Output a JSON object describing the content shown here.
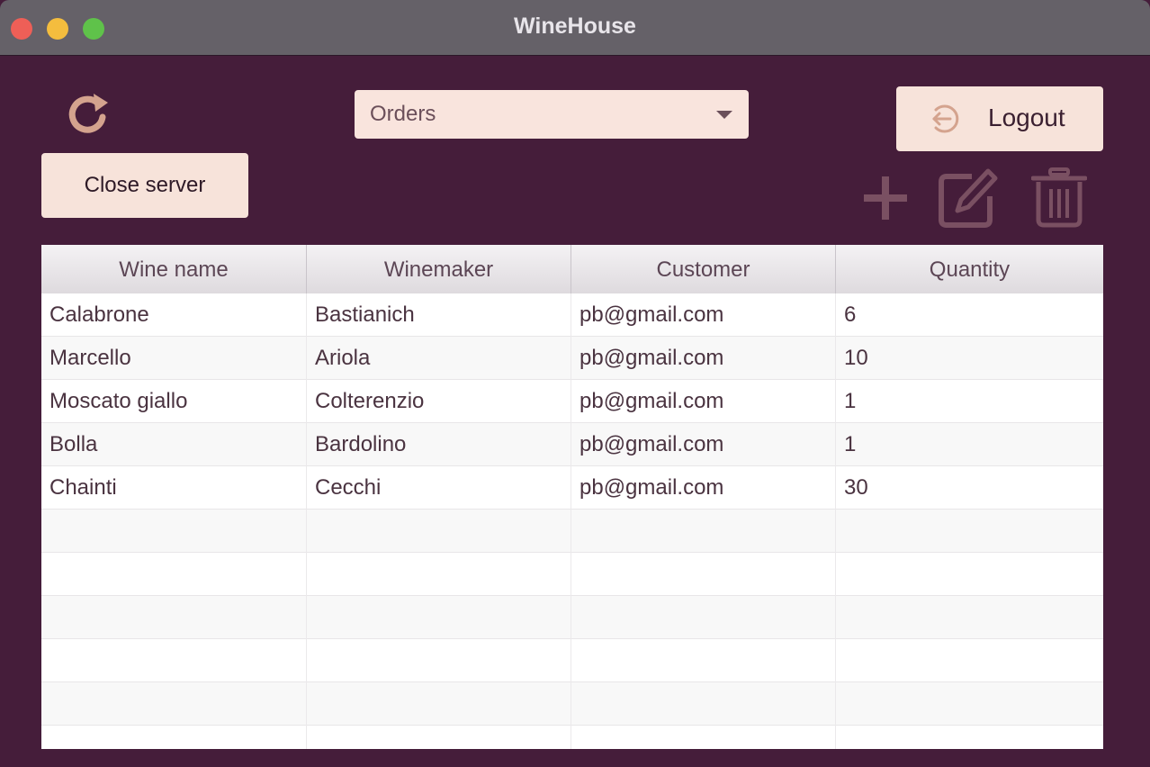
{
  "window": {
    "title": "WineHouse"
  },
  "toolbar": {
    "refresh_icon": "refresh-icon",
    "view_select": {
      "value": "Orders"
    },
    "logout_label": "Logout",
    "close_server_label": "Close server",
    "add_icon": "plus-icon",
    "edit_icon": "edit-icon",
    "delete_icon": "trash-icon"
  },
  "table": {
    "columns": [
      "Wine name",
      "Winemaker",
      "Customer",
      "Quantity"
    ],
    "rows": [
      [
        "Calabrone",
        "Bastianich",
        "pb@gmail.com",
        "6"
      ],
      [
        "Marcello",
        "Ariola",
        "pb@gmail.com",
        "10"
      ],
      [
        "Moscato giallo",
        "Colterenzio",
        "pb@gmail.com",
        "1"
      ],
      [
        "Bolla",
        "Bardolino",
        "pb@gmail.com",
        "1"
      ],
      [
        "Chainti",
        "Cecchi",
        "pb@gmail.com",
        "30"
      ]
    ]
  },
  "colors": {
    "background": "#451d3a",
    "button_fill": "#f7e3da",
    "icon_accent": "#d4a38e",
    "tool_icon": "#7a5062"
  }
}
